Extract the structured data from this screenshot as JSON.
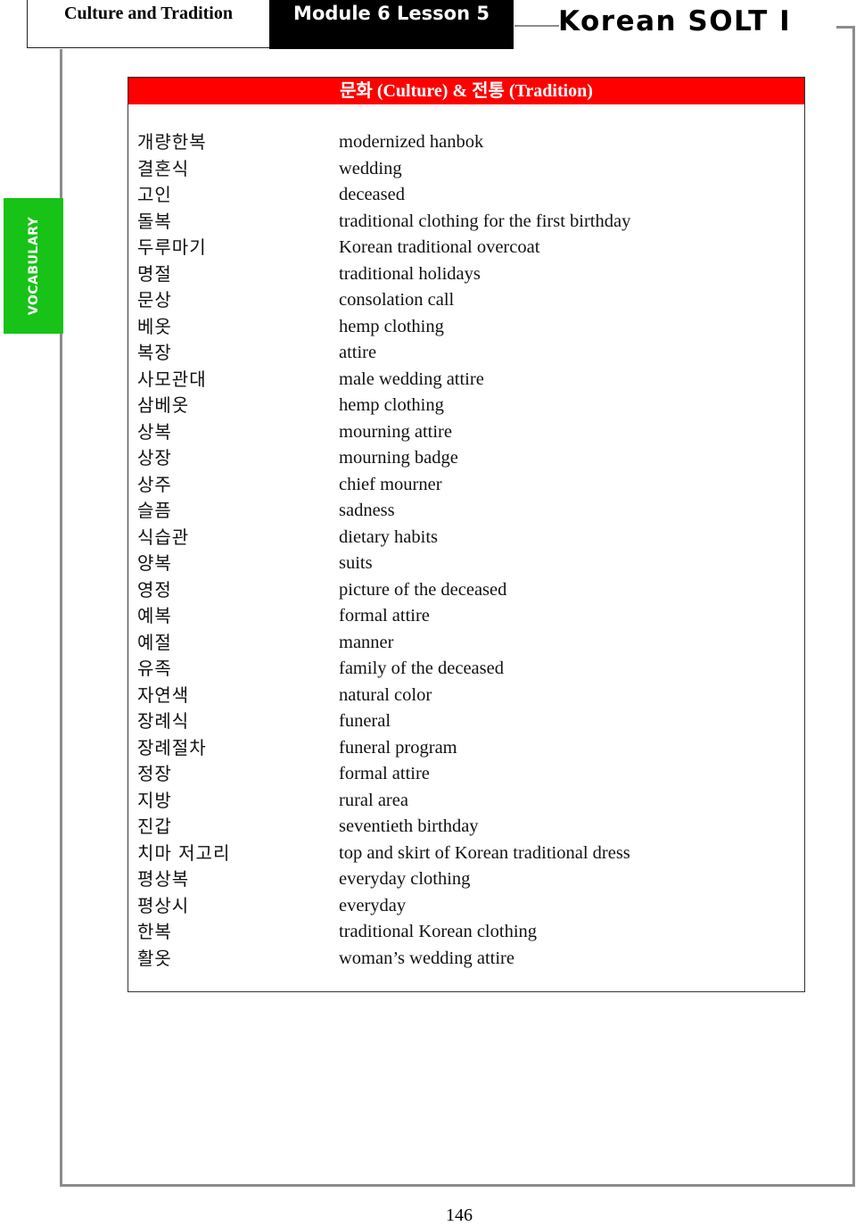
{
  "header": {
    "section": "Culture and Tradition",
    "module": "Module 6 Lesson 5",
    "course": "Korean SOLT I"
  },
  "side_tab": {
    "label": "VOCABULARY",
    "color": "#16c316"
  },
  "vocabulary": {
    "title": "문화 (Culture)  &  전통 (Tradition)",
    "title_color": "#ff0000",
    "entries": [
      {
        "ko": "개량한복",
        "en": "modernized hanbok"
      },
      {
        "ko": "결혼식",
        "en": "wedding"
      },
      {
        "ko": "고인",
        "en": "deceased"
      },
      {
        "ko": "돌복",
        "en": "traditional clothing for the first birthday"
      },
      {
        "ko": "두루마기",
        "en": "Korean traditional overcoat"
      },
      {
        "ko": "명절",
        "en": "traditional holidays"
      },
      {
        "ko": "문상",
        "en": "consolation call"
      },
      {
        "ko": "베옷",
        "en": "hemp clothing"
      },
      {
        "ko": "복장",
        "en": "attire"
      },
      {
        "ko": "사모관대",
        "en": "male wedding attire"
      },
      {
        "ko": "삼베옷",
        "en": "hemp clothing"
      },
      {
        "ko": "상복",
        "en": "mourning attire"
      },
      {
        "ko": "상장",
        "en": "mourning badge"
      },
      {
        "ko": "상주",
        "en": "chief mourner"
      },
      {
        "ko": "슬픔",
        "en": "sadness"
      },
      {
        "ko": "식습관",
        "en": "dietary habits"
      },
      {
        "ko": "양복",
        "en": "suits"
      },
      {
        "ko": "영정",
        "en": "picture of the deceased"
      },
      {
        "ko": "예복",
        "en": "formal attire"
      },
      {
        "ko": "예절",
        "en": "manner"
      },
      {
        "ko": "유족",
        "en": "family of the deceased"
      },
      {
        "ko": "자연색",
        "en": "natural color"
      },
      {
        "ko": "장례식",
        "en": "funeral"
      },
      {
        "ko": "장례절차",
        "en": "funeral program"
      },
      {
        "ko": "정장",
        "en": "formal attire"
      },
      {
        "ko": "지방",
        "en": "rural area"
      },
      {
        "ko": "진갑",
        "en": "seventieth birthday"
      },
      {
        "ko": "치마 저고리",
        "en": "top and skirt of Korean traditional dress"
      },
      {
        "ko": "평상복",
        "en": "everyday clothing"
      },
      {
        "ko": "평상시",
        "en": "everyday"
      },
      {
        "ko": "한복",
        "en": "traditional Korean clothing"
      },
      {
        "ko": "활옷",
        "en": "woman’s wedding attire"
      }
    ]
  },
  "footer": {
    "page_number": "146"
  }
}
